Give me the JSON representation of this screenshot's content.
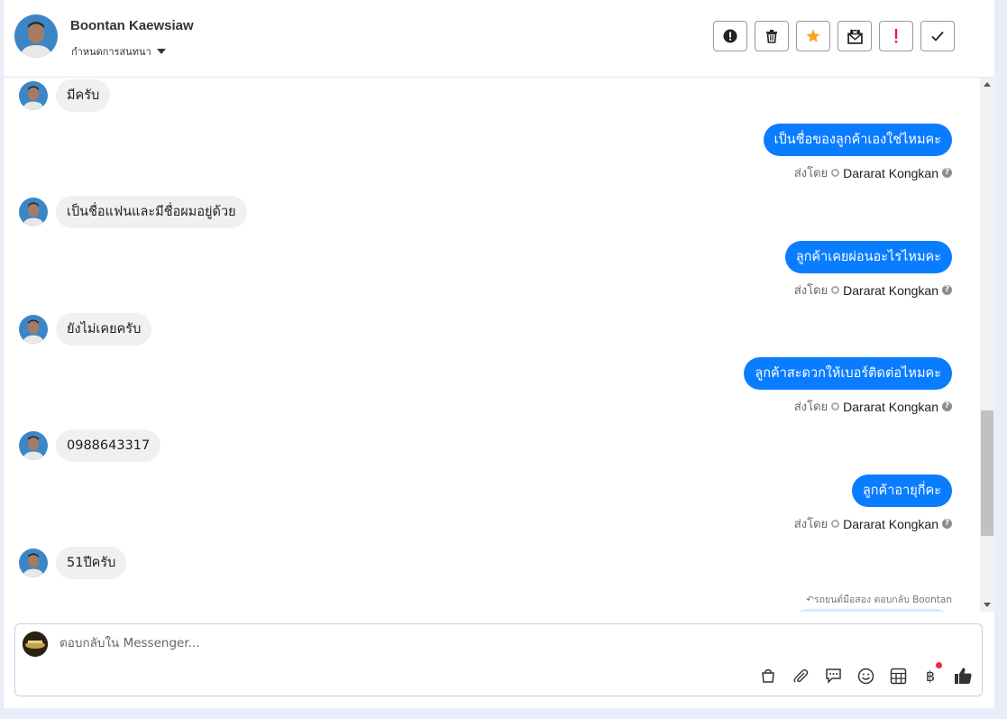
{
  "header": {
    "contact_name": "Boontan Kaewsiaw",
    "assign_label": "กำหนดการสนทนา",
    "toolbar": [
      {
        "name": "spam-button",
        "icon": "alert-circle-icon"
      },
      {
        "name": "delete-button",
        "icon": "trash-icon"
      },
      {
        "name": "star-button",
        "icon": "star-icon",
        "color": "#f5a623"
      },
      {
        "name": "mark-unread-button",
        "icon": "envelope-x-icon"
      },
      {
        "name": "follow-up-button",
        "icon": "exclamation-icon",
        "color": "#e41e3f"
      },
      {
        "name": "done-button",
        "icon": "check-icon"
      }
    ]
  },
  "messages": [
    {
      "dir": "in",
      "text": "มีครับ"
    },
    {
      "dir": "out",
      "text": "เป็นชื่อของลูกค้าเองใช่ไหมคะ",
      "sent_by_label": "ส่งโดย",
      "agent": "Dararat Kongkan"
    },
    {
      "dir": "in",
      "text": "เป็นชื่อแฟนและมีชื่อผมอยู่ด้วย"
    },
    {
      "dir": "out",
      "text": "ลูกค้าเคยผ่อนอะไรไหมคะ",
      "sent_by_label": "ส่งโดย",
      "agent": "Dararat Kongkan"
    },
    {
      "dir": "in",
      "text": "ยังไม่เคยครับ"
    },
    {
      "dir": "out",
      "text": "ลูกค้าสะดวกให้เบอร์ติดต่อไหมคะ",
      "sent_by_label": "ส่งโดย",
      "agent": "Dararat Kongkan"
    },
    {
      "dir": "in",
      "text": "0988643317"
    },
    {
      "dir": "out",
      "text": "ลูกค้าอายุกี่คะ",
      "sent_by_label": "ส่งโดย",
      "agent": "Dararat Kongkan"
    },
    {
      "dir": "in",
      "text": "51ปีครับ"
    }
  ],
  "reply_note": "รถยนต์มือสอง ตอบกลับ Boontan",
  "composer": {
    "placeholder": "ตอบกลับใน Messenger...",
    "tools": [
      "shopping-bag-icon",
      "paperclip-icon",
      "chat-bubble-icon",
      "smiley-icon",
      "table-icon",
      "baht-icon",
      "thumbs-up-icon"
    ]
  },
  "colors": {
    "outgoing_bubble": "#0a7cff",
    "incoming_bubble": "#f0f0f0",
    "star": "#f5a623",
    "alert": "#e41e3f"
  }
}
